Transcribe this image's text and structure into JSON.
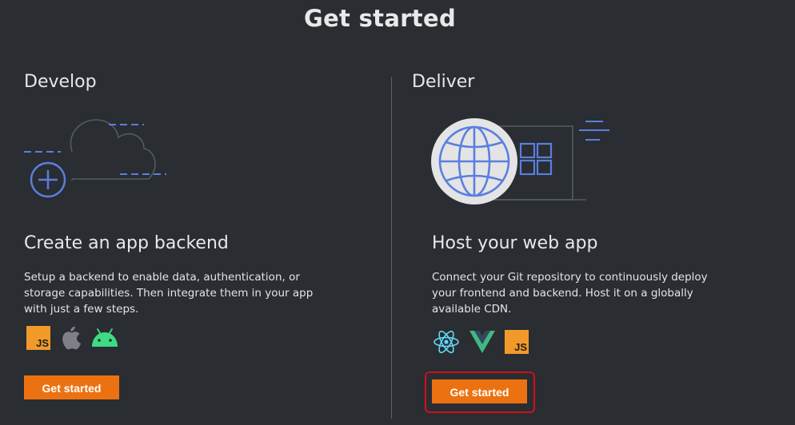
{
  "page": {
    "title": "Get started"
  },
  "develop": {
    "heading": "Develop",
    "card_title": "Create an app backend",
    "description_lines": [
      "Setup a backend to enable data, authentication, or",
      "storage capabilities. Then integrate them in your app",
      "with just a few steps."
    ],
    "platform_icons": [
      "javascript-icon",
      "apple-icon",
      "android-icon"
    ],
    "js_label": "JS",
    "button_label": "Get started"
  },
  "deliver": {
    "heading": "Deliver",
    "card_title": "Host your web app",
    "description_lines": [
      "Connect your Git repository to continuously deploy",
      "your frontend and backend. Host it on a globally",
      "available CDN."
    ],
    "framework_icons": [
      "react-icon",
      "vue-icon",
      "javascript-icon"
    ],
    "js_label": "JS",
    "button_label": "Get started"
  },
  "colors": {
    "background": "#2a2d32",
    "accent": "#ec7211",
    "illustration_blue": "#5a7fe0",
    "highlight_border": "#d0101b"
  }
}
